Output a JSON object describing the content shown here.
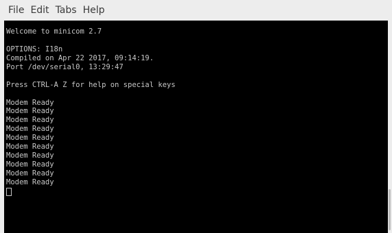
{
  "menu": {
    "file": "File",
    "edit": "Edit",
    "tabs": "Tabs",
    "help": "Help"
  },
  "terminal": {
    "lines": [
      "Welcome to minicom 2.7",
      "",
      "OPTIONS: I18n",
      "Compiled on Apr 22 2017, 09:14:19.",
      "Port /dev/serial0, 13:29:47",
      "",
      "Press CTRL-A Z for help on special keys",
      "",
      "Modem Ready",
      "Modem Ready",
      "Modem Ready",
      "Modem Ready",
      "Modem Ready",
      "Modem Ready",
      "Modem Ready",
      "Modem Ready",
      "Modem Ready",
      "Modem Ready"
    ]
  },
  "colors": {
    "terminal_bg": "#000000",
    "terminal_fg": "#c7c7c7",
    "menubar_bg": "#ededed"
  }
}
